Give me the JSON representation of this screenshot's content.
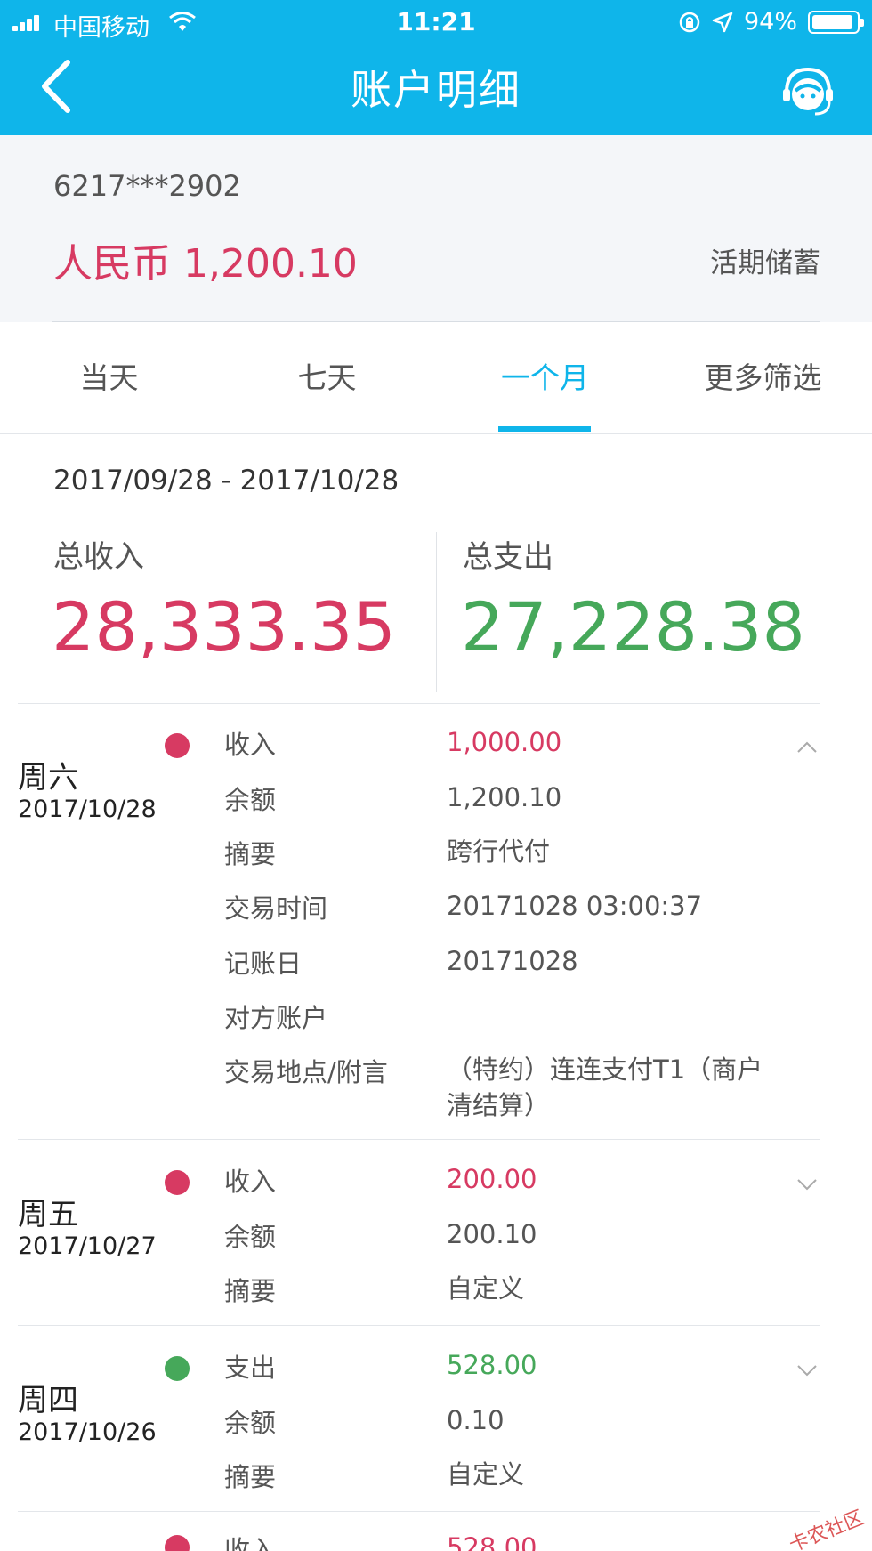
{
  "status": {
    "carrier": "中国移动",
    "time": "11:21",
    "battery": "94%",
    "battery_level": 0.94
  },
  "nav": {
    "title": "账户明细"
  },
  "account": {
    "number": "6217***2902",
    "balance": "人民币 1,200.10",
    "type": "活期储蓄"
  },
  "tabs": [
    {
      "label": "当天",
      "active": false
    },
    {
      "label": "七天",
      "active": false
    },
    {
      "label": "一个月",
      "active": true
    },
    {
      "label": "更多筛选",
      "active": false
    }
  ],
  "summary": {
    "range": "2017/09/28 - 2017/10/28",
    "income_label": "总收入",
    "income_value": "28,333.35",
    "expense_label": "总支出",
    "expense_value": "27,228.38"
  },
  "transactions": [
    {
      "weekday": "周六",
      "date": "2017/10/28",
      "kind": "in",
      "expanded": true,
      "rows": [
        {
          "key": "收入",
          "value": "1,000.00"
        },
        {
          "key": "余额",
          "value": "1,200.10"
        },
        {
          "key": "摘要",
          "value": "跨行代付"
        },
        {
          "key": "交易时间",
          "value": "20171028 03:00:37"
        },
        {
          "key": "记账日",
          "value": "20171028"
        },
        {
          "key": "对方账户",
          "value": ""
        },
        {
          "key": "交易地点/附言",
          "value": "（特约）连连支付T1（商户清结算）"
        }
      ]
    },
    {
      "weekday": "周五",
      "date": "2017/10/27",
      "kind": "in",
      "expanded": false,
      "rows": [
        {
          "key": "收入",
          "value": "200.00"
        },
        {
          "key": "余额",
          "value": "200.10"
        },
        {
          "key": "摘要",
          "value": "自定义"
        }
      ]
    },
    {
      "weekday": "周四",
      "date": "2017/10/26",
      "kind": "out",
      "expanded": false,
      "rows": [
        {
          "key": "支出",
          "value": "528.00"
        },
        {
          "key": "余额",
          "value": "0.10"
        },
        {
          "key": "摘要",
          "value": "自定义"
        }
      ]
    },
    {
      "weekday": "",
      "date": "",
      "kind": "in",
      "expanded": false,
      "rows": [
        {
          "key": "收入",
          "value": "528.00"
        }
      ]
    }
  ],
  "watermark": "卡农社区",
  "colors": {
    "primary": "#0fb5ea",
    "income": "#d73a62",
    "expense": "#46a85a"
  }
}
